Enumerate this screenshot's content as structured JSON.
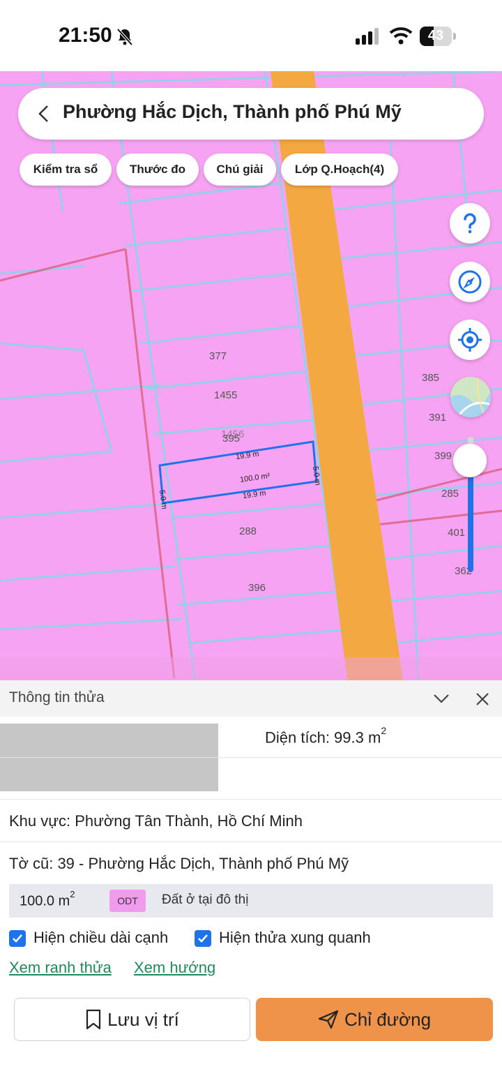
{
  "status_bar": {
    "time": "21:50",
    "battery_level": "43",
    "battery_fraction": 0.43
  },
  "search": {
    "title": "Phường Hắc Dịch, Thành phố Phú Mỹ"
  },
  "toolbar": {
    "chips": [
      "Kiểm tra sổ",
      "Thước đo",
      "Chú giải",
      "Lớp Q.Hoạch(4)"
    ]
  },
  "map": {
    "parcel_labels": [
      "377",
      "1455",
      "1456",
      "395",
      "288",
      "396"
    ],
    "side_labels": [
      "385",
      "391",
      "399",
      "285",
      "401",
      "362"
    ],
    "selected_parcel": {
      "top_edge": "19.9 m",
      "bottom_edge": "19.9 m",
      "right_edge": "5.0 m",
      "left_edge": "5.0 m",
      "area": "100.0 m²"
    },
    "zoom_fraction": 0.85,
    "colors": {
      "residential": "#f7a3f3",
      "road": "#f4a841",
      "selection": "#1e73e8"
    }
  },
  "panel": {
    "title": "Thông tin thửa",
    "area_label": "Diện tích: 99.3 m",
    "area_sup": "2",
    "region": "Khu vực: Phường Tân Thành, Hồ Chí Minh",
    "old_sheet": "Tờ cũ: 39 - Phường Hắc Dịch, Thành phố Phú Mỹ",
    "land_use": {
      "area": "100.0 m",
      "area_sup": "2",
      "code": "ODT",
      "description": "Đất ở tại đô thị"
    },
    "checkbox_edges": "Hiện chiều dài cạnh",
    "checkbox_neighbors": "Hiện thửa xung quanh",
    "link_boundary": "Xem ranh thửa",
    "link_direction": "Xem hướng",
    "save_button": "Lưu vị trí",
    "route_button": "Chỉ đường"
  }
}
